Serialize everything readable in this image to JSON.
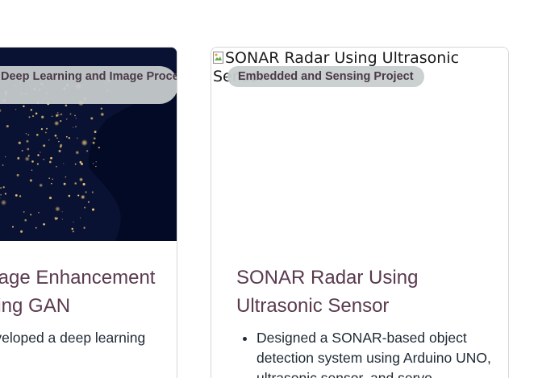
{
  "cards": [
    {
      "category": "Deep Learning and Image Processing",
      "title": "Image Enhancement using GAN",
      "bullet": "Developed a deep learning"
    },
    {
      "image_alt": "SONAR Radar Using Ultrasonic Sensor",
      "category": "Embedded and Sensing Project",
      "title": "SONAR Radar Using Ultrasonic Sensor",
      "bullet": "Designed a SONAR-based object detection system using Arduino UNO, ultrasonic sensor, and servo"
    }
  ],
  "colors": {
    "title": "#5a3a4e",
    "pill_bg": "#c8cdcd",
    "pill_text": "#4b3a48",
    "night_bg": "#030a26"
  }
}
